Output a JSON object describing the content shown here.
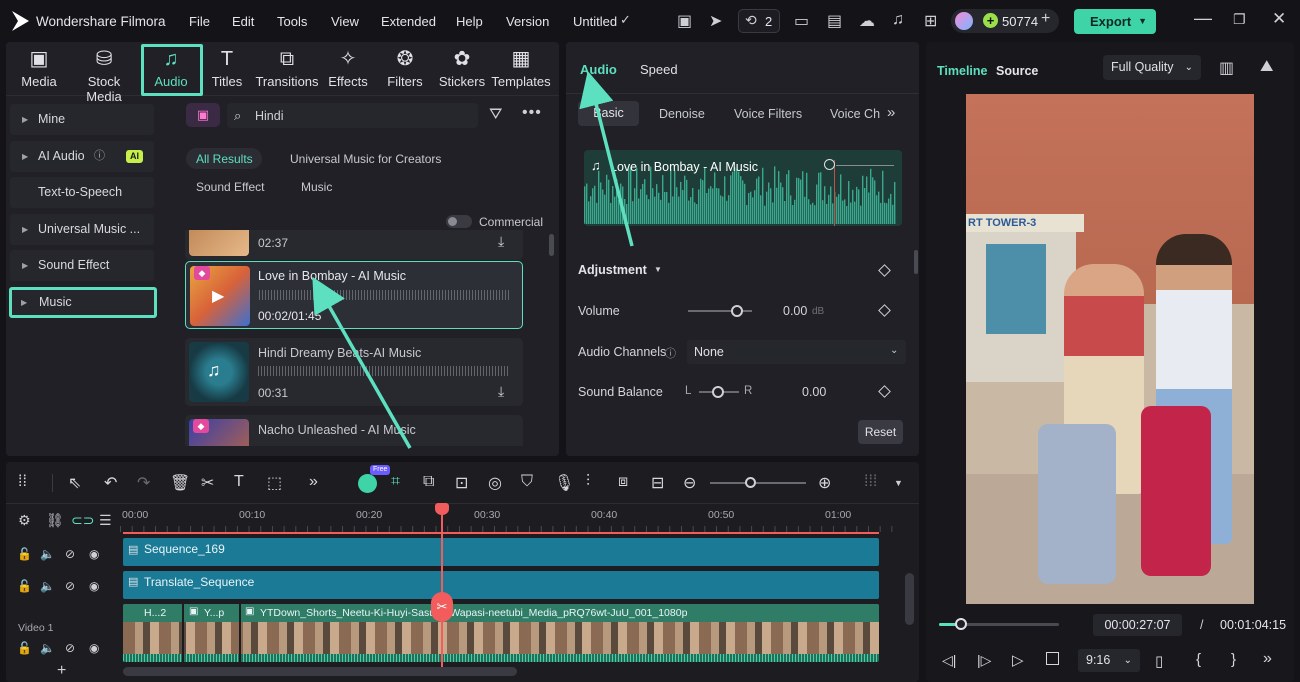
{
  "app": {
    "name": "Wondershare Filmora",
    "project": "Untitled"
  },
  "menu": [
    "File",
    "Edit",
    "Tools",
    "View",
    "Extended",
    "Help",
    "Version"
  ],
  "header": {
    "notif_count": "2",
    "credits": "50774",
    "export_label": "Export"
  },
  "media_tabs": [
    {
      "label": "Media",
      "icon": "media-icon"
    },
    {
      "label": "Stock Media",
      "icon": "stock-media-icon"
    },
    {
      "label": "Audio",
      "icon": "music-note-icon"
    },
    {
      "label": "Titles",
      "icon": "title-T-icon"
    },
    {
      "label": "Transitions",
      "icon": "transitions-icon"
    },
    {
      "label": "Effects",
      "icon": "effects-icon"
    },
    {
      "label": "Filters",
      "icon": "filters-icon"
    },
    {
      "label": "Stickers",
      "icon": "stickers-icon"
    },
    {
      "label": "Templates",
      "icon": "templates-icon"
    }
  ],
  "sidebar": [
    {
      "label": "Mine"
    },
    {
      "label": "AI Audio",
      "badge": "AI"
    },
    {
      "label": "Text-to-Speech"
    },
    {
      "label": "Universal Music ..."
    },
    {
      "label": "Sound Effect"
    },
    {
      "label": "Music"
    }
  ],
  "search": {
    "value": "Hindi"
  },
  "filters": {
    "all": "All Results",
    "umc": "Universal Music for Creators",
    "sfx": "Sound Effect",
    "music": "Music",
    "commercial": "Commercial"
  },
  "audio_list": [
    {
      "title": "",
      "duration": "02:37"
    },
    {
      "title": "Love in Bombay - AI Music",
      "duration": "00:02/01:45"
    },
    {
      "title": "Hindi Dreamy Beats-AI Music",
      "duration": "00:31"
    },
    {
      "title": "Nacho Unleashed - AI Music",
      "duration": ""
    }
  ],
  "props": {
    "tabs": [
      "Audio",
      "Speed"
    ],
    "subtabs": [
      "Basic",
      "Denoise",
      "Voice Filters",
      "Voice Ch"
    ],
    "clip_title": "Love in Bombay - AI Music",
    "adjustment": "Adjustment",
    "volume_label": "Volume",
    "volume_value": "0.00",
    "volume_unit": "dB",
    "channels_label": "Audio Channels",
    "channels_value": "None",
    "balance_label": "Sound Balance",
    "balance_l": "L",
    "balance_r": "R",
    "balance_value": "0.00",
    "reset": "Reset"
  },
  "preview": {
    "tab_timeline": "Timeline",
    "tab_source": "Source",
    "quality": "Full Quality",
    "sign1": "RT TOWER-3",
    "current": "00:00:27:07",
    "sep": "/",
    "total": "00:01:04:15",
    "ratio": "9:16",
    "progress": 0.18
  },
  "timeline": {
    "ruler": [
      "00:00",
      "00:10",
      "00:20",
      "00:30",
      "00:40",
      "00:50",
      "01:00"
    ],
    "free_badge": "Free",
    "tracks": [
      {
        "name": "Sequence_169"
      },
      {
        "name": "Translate_Sequence"
      }
    ],
    "video_label": "Video 1",
    "clips": [
      "H...2",
      "Y...p",
      "YTDown_Shorts_Neetu-Ki-Huyi-Sasural-Wapasi-neetubi_Media_pRQ76wt-JuU_001_1080p"
    ]
  },
  "colors": {
    "accent": "#5de0c0",
    "export": "#3fd3a8",
    "playhead": "#f25c5c",
    "track": "#1b7a95"
  }
}
